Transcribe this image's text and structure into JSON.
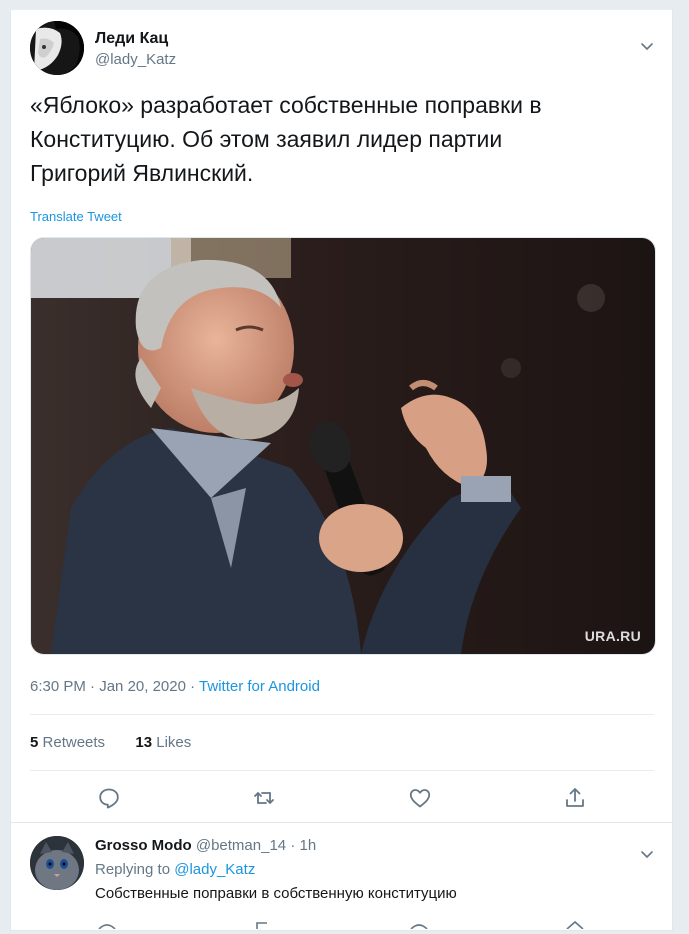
{
  "tweet": {
    "author_name": "Леди Кац",
    "author_handle": "@lady_Katz",
    "text": "«Яблоко» разработает собственные поправки в\nКонституцию. Об этом заявил лидер партии\nГригорий Явлинский.",
    "translate_label": "Translate Tweet",
    "photo_watermark": "URA.RU",
    "time": "6:30 PM",
    "date": "Jan 20, 2020",
    "source": "Twitter for Android",
    "retweets_count": "5",
    "retweets_label": "Retweets",
    "likes_count": "13",
    "likes_label": "Likes",
    "actions": [
      "reply-icon",
      "retweet-icon",
      "like-icon",
      "share-icon"
    ]
  },
  "reply": {
    "author_name": "Grosso Modo",
    "author_handle": "@betman_14",
    "time_ago": "1h",
    "replying_label": "Replying to",
    "replying_to": "@lady_Katz",
    "text": "Собственные поправки в собственную конституцию"
  },
  "colors": {
    "accent": "#1b95e0",
    "secondary_text": "#657786",
    "background": "#e6ecf0"
  }
}
